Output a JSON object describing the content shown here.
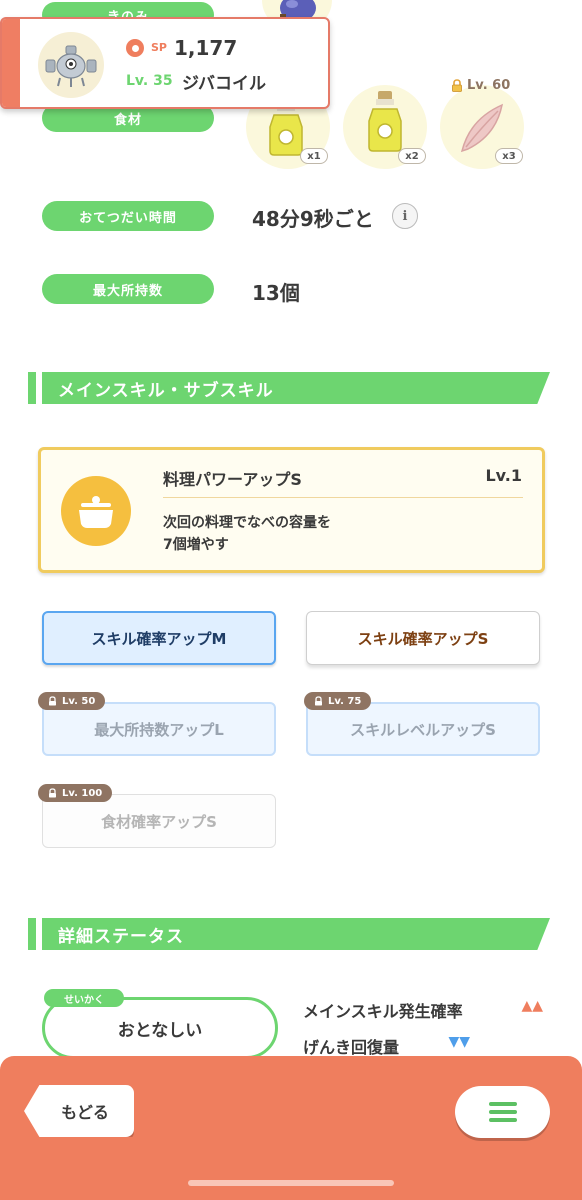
{
  "popup": {
    "sp_label": "SP",
    "sp_value": "1,177",
    "level": "Lv. 35",
    "name": "ジバコイル"
  },
  "info_labels": {
    "skill": "きのみ",
    "ingredients": "食材",
    "help_time": "おてつだい時間",
    "max_carry": "最大所持数"
  },
  "ingredients": [
    {
      "qty": "x1",
      "icon": "oil-bottle-icon"
    },
    {
      "qty": "x2",
      "icon": "oil-bottle-icon"
    },
    {
      "qty": "x3",
      "icon": "leaf-icon",
      "lock_level": "Lv. 60"
    }
  ],
  "help_time": "48分9秒ごと",
  "max_carry": "13個",
  "section_skills": "メインスキル・サブスキル",
  "main_skill": {
    "name": "料理パワーアップS",
    "level": "Lv.1",
    "description_line1": "次回の料理でなべの容量を",
    "description_line2": "7個増やす",
    "icon": "pot-icon"
  },
  "subskills": [
    {
      "label": "スキル確率アップM",
      "lock": ""
    },
    {
      "label": "スキル確率アップS",
      "lock": ""
    },
    {
      "label": "最大所持数アップL",
      "lock": "Lv. 50"
    },
    {
      "label": "スキルレベルアップS",
      "lock": "Lv. 75"
    },
    {
      "label": "食材確率アップS",
      "lock": "Lv. 100"
    }
  ],
  "section_details": "詳細ステータス",
  "nature": {
    "tag": "せいかく",
    "value": "おとなしい"
  },
  "nature_effects": [
    {
      "label": "メインスキル発生確率",
      "arrows": "▲▲",
      "color": "#ef7e5e"
    },
    {
      "label": "げんき回復量",
      "arrows": "▼▼",
      "color": "#4f9eea"
    }
  ],
  "bottom": {
    "back": "もどる",
    "menu_icon": "hamburger-menu-icon"
  },
  "colors": {
    "accent_green": "#6dd570",
    "bottom_bar": "#ef7e5e",
    "skill_card_border": "#f0cb5e"
  }
}
